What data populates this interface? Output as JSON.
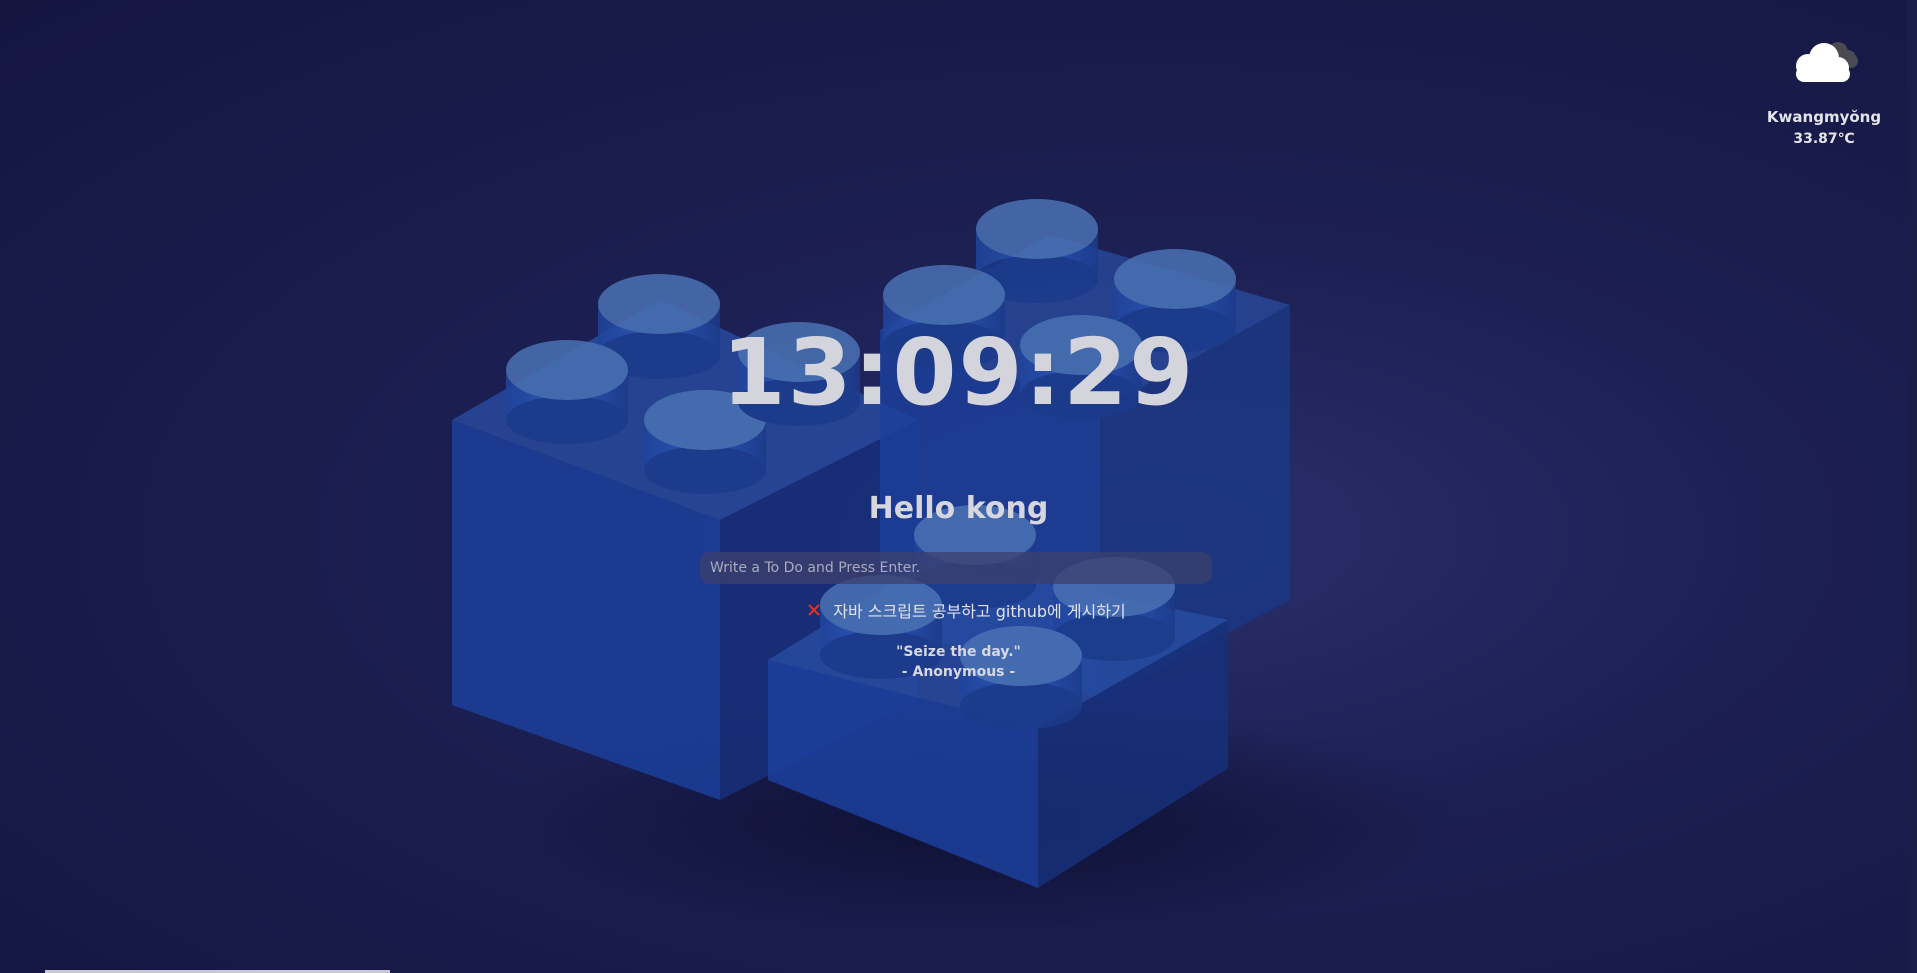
{
  "weather": {
    "icon": "cloud-icon",
    "city": "Kwangmyŏng",
    "temperature": "33.87℃"
  },
  "clock": {
    "time": "13:09:29"
  },
  "greeting": {
    "text": "Hello kong"
  },
  "todo": {
    "placeholder": "Write a To Do and Press Enter.",
    "items": [
      {
        "text": "자바 스크립트 공부하고 github에 게시하기",
        "delete_icon": "close-icon",
        "delete_color": "#e0321c"
      }
    ]
  },
  "quote": {
    "text": "\"Seize the day.\"",
    "author": "- Anonymous -"
  },
  "colors": {
    "background": "#1c1f52",
    "brick": "#1f3f9a",
    "delete": "#e0321c"
  }
}
